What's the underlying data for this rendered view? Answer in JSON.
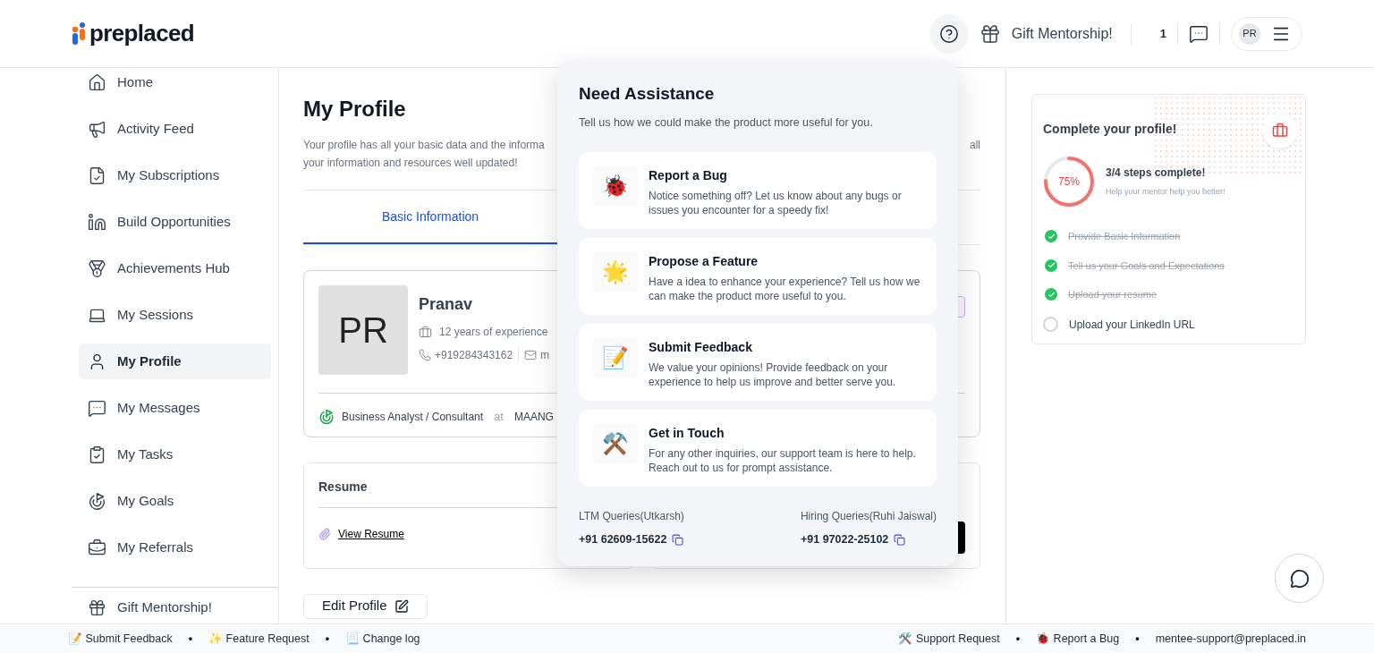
{
  "header": {
    "logo": "preplaced",
    "gift_label": "Gift Mentorship!",
    "count": "1",
    "avatar": "PR"
  },
  "sidebar": {
    "items": [
      {
        "label": "Home",
        "selected": false
      },
      {
        "label": "Activity Feed",
        "selected": false
      },
      {
        "label": "My Subscriptions",
        "selected": false
      },
      {
        "label": "Build Opportunities",
        "selected": false
      },
      {
        "label": "Achievements Hub",
        "selected": false
      },
      {
        "label": "My Sessions",
        "selected": false
      },
      {
        "label": "My Profile",
        "selected": true
      },
      {
        "label": "My Messages",
        "selected": false
      },
      {
        "label": "My Tasks",
        "selected": false
      },
      {
        "label": "My Goals",
        "selected": false
      },
      {
        "label": "My Referrals",
        "selected": false
      }
    ],
    "bottom_item": "Gift Mentorship!"
  },
  "main": {
    "title": "My Profile",
    "description_line_1": "Your profile has all your basic data and the informa",
    "description_line_1_end": "all",
    "description_line_2": "your information and resources well updated!",
    "tabs": [
      {
        "label": "Basic Information",
        "selected": true
      }
    ],
    "profile": {
      "avatar": "PR",
      "name": "Pranav",
      "experience": "12 years of experience",
      "phone": "+919284343162",
      "email": "m",
      "role": "Business Analyst / Consultant",
      "at": "at",
      "company": "MAANG"
    },
    "resume": {
      "title": "Resume",
      "link": "View Resume"
    },
    "edit_button": "Edit Profile"
  },
  "assistance": {
    "title": "Need Assistance",
    "subtitle": "Tell us how we could make the product more useful for you.",
    "options": [
      {
        "emoji": "🐞",
        "title": "Report a Bug",
        "text": "Notice something off? Let us know about any bugs or issues you encounter for a speedy fix!"
      },
      {
        "emoji": "🌟",
        "title": "Propose a Feature",
        "text": "Have a idea to enhance your experience? Tell us how we can make the product more useful to you."
      },
      {
        "emoji": "📝",
        "title": "Submit Feedback",
        "text": "We value your opinions! Provide feedback on your experience to help us improve and better serve you."
      },
      {
        "emoji": "⚒️",
        "title": "Get in Touch",
        "text": "For any other inquiries, our support team is here to help. Reach out to us for prompt assistance."
      }
    ],
    "contacts": [
      {
        "label": "LTM Queries(Utkarsh)",
        "phone": "+91 62609-15622"
      },
      {
        "label": "Hiring Queries(Ruhi Jaiswal)",
        "phone": "+91 97022-25102"
      }
    ]
  },
  "completion": {
    "title": "Complete your profile!",
    "percent": "75%",
    "steps_title": "3/4 steps complete!",
    "steps_subtitle": "Help your mentor help you better!",
    "steps": [
      {
        "label": "Provide Basic Information",
        "done": true
      },
      {
        "label": "Tell us your Goals and Expectations",
        "done": true
      },
      {
        "label": "Upload your resume",
        "done": true
      },
      {
        "label": "Upload your LinkedIn URL",
        "done": false
      }
    ]
  },
  "footer": {
    "left": [
      {
        "kind": "link",
        "text": "📝 Submit Feedback"
      },
      {
        "kind": "dot",
        "text": "•"
      },
      {
        "kind": "link",
        "text": "✨ Feature Request"
      },
      {
        "kind": "dot",
        "text": "•"
      },
      {
        "kind": "link",
        "text": "📃 Change log"
      }
    ],
    "right": [
      {
        "kind": "link",
        "text": "🛠️ Support Request"
      },
      {
        "kind": "dot",
        "text": "•"
      },
      {
        "kind": "link",
        "text": "🐞 Report a Bug"
      },
      {
        "kind": "dot",
        "text": "•"
      },
      {
        "kind": "link",
        "text": "mentee-support@preplaced.in"
      }
    ]
  }
}
